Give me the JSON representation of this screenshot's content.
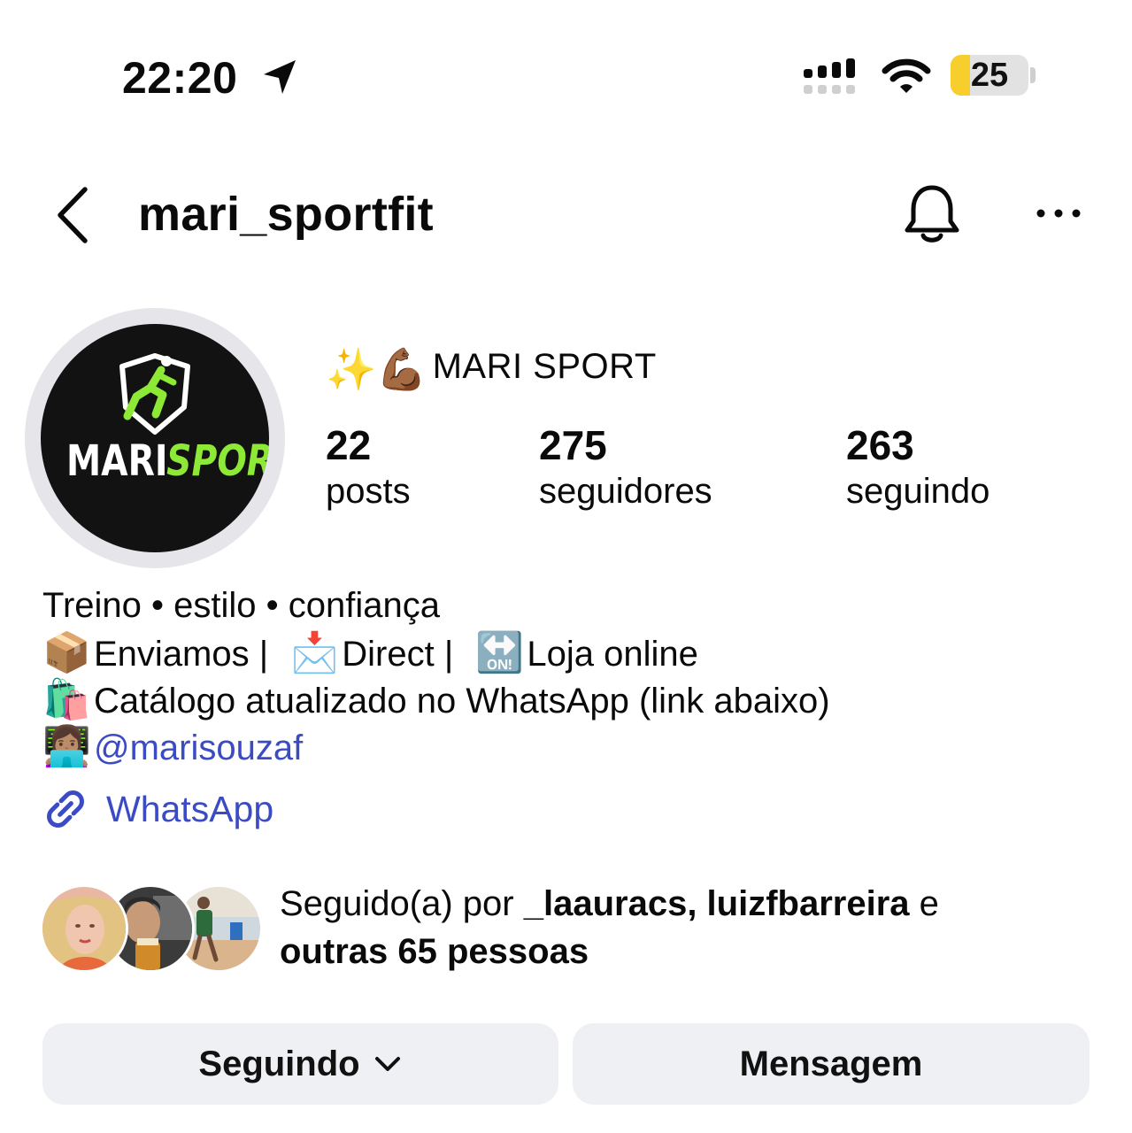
{
  "status_bar": {
    "time": "22:20",
    "battery_level": "25",
    "battery_fraction": 0.25,
    "icons": [
      "location-arrow-icon",
      "cellular-signal-icon",
      "wifi-icon",
      "battery-icon"
    ]
  },
  "header": {
    "back_icon": "chevron-left-icon",
    "username": "mari_sportfit",
    "bell_icon": "bell-icon",
    "more_icon": "ellipsis-icon"
  },
  "profile": {
    "avatar_logo": "MARISPORT",
    "name_emoji": "✨💪🏾",
    "display_name": "MARI SPORT",
    "stats": {
      "posts": {
        "value": "22",
        "label": "posts"
      },
      "followers": {
        "value": "275",
        "label": "seguidores"
      },
      "following": {
        "value": "263",
        "label": "seguindo"
      }
    }
  },
  "bio": {
    "line1": "Treino • estilo • confiança",
    "line2_emoji_a": "📦",
    "line2_text_a": "Enviamos |",
    "line2_emoji_b": "📩",
    "line2_text_b": "Direct |",
    "line2_emoji_c": "🔛",
    "line2_text_c": "Loja online",
    "line3_emoji": "🛍️",
    "line3_text": "Catálogo atualizado no WhatsApp (link abaixo)",
    "line4_emoji": "👩🏽‍💻",
    "mention": "@marisouzaf",
    "link_icon": "link-icon",
    "link_text": "WhatsApp"
  },
  "followed_by": {
    "prefix": "Seguido(a) por ",
    "names": "_laauracs, luizfbarreira",
    "joiner": " e",
    "others": "outras 65 pessoas"
  },
  "buttons": {
    "following": "Seguindo",
    "following_icon": "chevron-down-icon",
    "message": "Mensagem"
  },
  "colors": {
    "link_blue": "#3b4bc4",
    "logo_green": "#8ee836",
    "battery_yellow": "#f7ce2b",
    "button_bg": "#eef0f3"
  }
}
